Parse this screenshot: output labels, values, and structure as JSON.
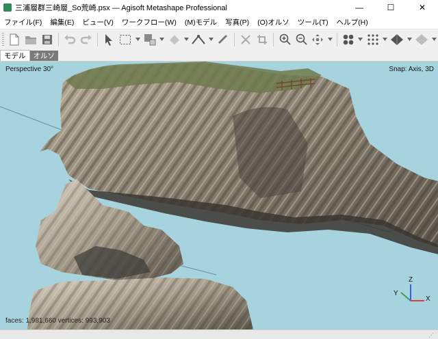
{
  "window": {
    "title": "三浦層群三崎層_So荒崎.psx — Agisoft Metashape Professional",
    "minimize_glyph": "—",
    "maximize_glyph": "☐",
    "close_glyph": "✕"
  },
  "menu": [
    "ファイル(F)",
    "編集(E)",
    "ビュー(V)",
    "ワークフロー(W)",
    "(M)モデル",
    "写真(P)",
    "(O)オルソ",
    "ツール(T)",
    "ヘルプ(H)"
  ],
  "toolbar": {
    "icons": [
      "new-file-icon",
      "open-folder-icon",
      "save-icon",
      "undo-icon",
      "redo-icon",
      "navigation-icon",
      "rectangle-selection-icon",
      "free-form-selection-icon",
      "draw-polygon-icon",
      "ruler-icon",
      "delete-icon",
      "crop-icon",
      "zoom-in-icon",
      "zoom-out-icon",
      "move-object-icon",
      "show-cameras-icon",
      "show-points-icon",
      "show-model-icon",
      "show-tiled-model-icon"
    ]
  },
  "tabs": [
    {
      "label": "モデル",
      "active": true
    },
    {
      "label": "オルソ",
      "active": false
    }
  ],
  "viewport": {
    "perspective_label": "Perspective 30°",
    "snap_label": "Snap: Axis, 3D",
    "stats_label": "faces: 1,981,660 vertices: 993,903",
    "axis": {
      "x": "X",
      "y": "Y",
      "z": "Z"
    },
    "colors": {
      "sea": "#a7d3df",
      "axis_x": "#e23b3b",
      "axis_y": "#3aa34a",
      "axis_z": "#3b5fe2"
    }
  }
}
